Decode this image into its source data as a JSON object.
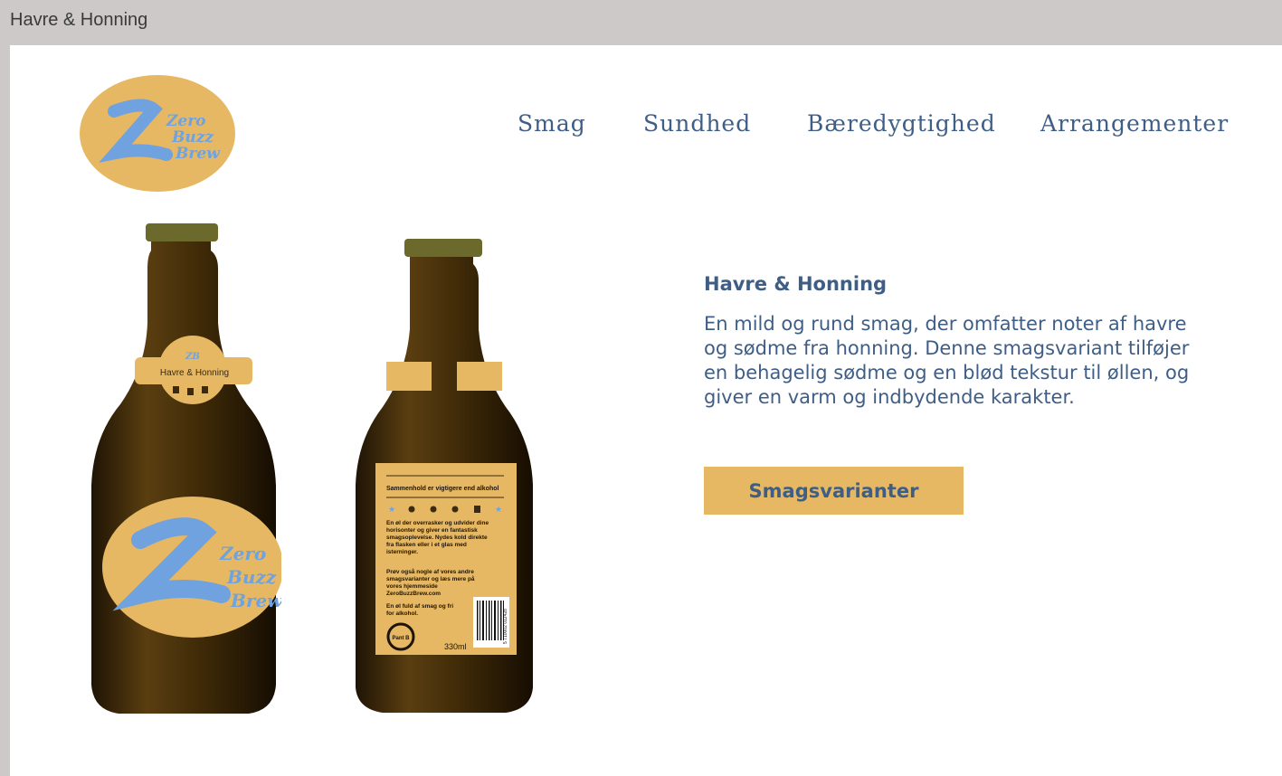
{
  "window": {
    "title": "Havre & Honning"
  },
  "brand": {
    "logo_line1": "Zero",
    "logo_line2": "Buzz",
    "logo_line3": "Brew",
    "logo_bg": "#e6b863",
    "logo_fg": "#6fa2df"
  },
  "nav": {
    "items": [
      {
        "label": "Smag"
      },
      {
        "label": "Sundhed"
      },
      {
        "label": "Bæredygtighed"
      },
      {
        "label": "Arrangementer"
      }
    ]
  },
  "product": {
    "title": "Havre & Honning",
    "description_lines": [
      "En mild og rund smag, der omfatter noter af havre",
      "og sødme fra honning. Denne smagsvariant tilføjer",
      "en behagelig sødme og en blød tekstur til øllen, og",
      "giver en varm og indbydende karakter."
    ],
    "button_label": "Smagsvarianter"
  },
  "front_bottle": {
    "neck_label_mark": "ZB",
    "neck_label_name": "Havre & Honning"
  },
  "back_bottle": {
    "heading": "Sammenhold er vigtigere end alkohol",
    "paragraph1": [
      "En øl der overrasker og udvider dine",
      "horisonter og giver en fantastisk",
      "smagsoplevelse.  Nydes kold direkte",
      "fra flasken eller i et glas med",
      "isterninger."
    ],
    "paragraph2": [
      "Prøv også nogle af vores andre",
      "smagsvarianter og læs mere på",
      "vores hjemmeside",
      "ZeroBuzzBrew.com"
    ],
    "paragraph3": [
      "En øl fuld af smag og fri",
      "for alkohol."
    ],
    "pant_label": "Pant B",
    "volume": "330ml",
    "barcode_number": "5 710002 012428"
  },
  "colors": {
    "text_blue": "#3f5e86",
    "gold": "#e6b863",
    "glass": "#3a2808",
    "cap": "#6b6a2c"
  }
}
